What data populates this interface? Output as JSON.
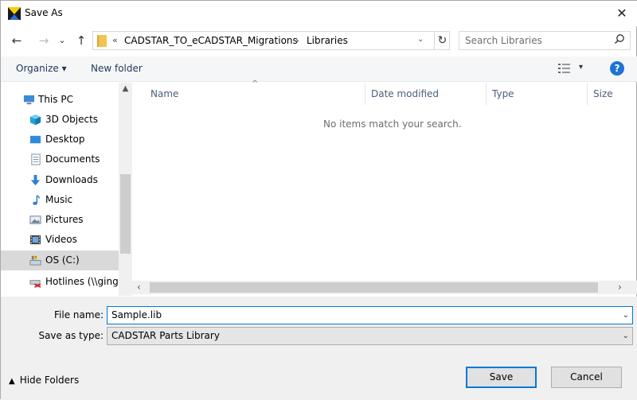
{
  "titlebar": {
    "title": "Save As",
    "close": "✕"
  },
  "nav": {
    "back": "←",
    "forward": "→",
    "history_drop": "⌄",
    "up": "↑",
    "breadcrumb": {
      "overflow": "«",
      "folder": "CADSTAR_TO_eCADSTAR_Migrations",
      "separator": "›",
      "current": "Libraries"
    },
    "addr_drop": "⌄",
    "refresh": "↻",
    "search_placeholder": "Search Libraries"
  },
  "toolbar": {
    "organize": "Organize ▾",
    "new_folder": "New folder",
    "view_drop": "▾",
    "help": "?"
  },
  "sidebar": {
    "items": [
      {
        "label": "This PC",
        "icon": "computer-icon"
      },
      {
        "label": "3D Objects",
        "icon": "cube-icon"
      },
      {
        "label": "Desktop",
        "icon": "desktop-icon"
      },
      {
        "label": "Documents",
        "icon": "documents-icon"
      },
      {
        "label": "Downloads",
        "icon": "downloads-icon"
      },
      {
        "label": "Music",
        "icon": "music-icon"
      },
      {
        "label": "Pictures",
        "icon": "pictures-icon"
      },
      {
        "label": "Videos",
        "icon": "videos-icon"
      },
      {
        "label": "OS (C:)",
        "icon": "drive-icon"
      },
      {
        "label": "Hotlines (\\\\ginge",
        "icon": "network-drive-icon"
      }
    ]
  },
  "content": {
    "columns": [
      "Name",
      "Date modified",
      "Type",
      "Size"
    ],
    "empty_message": "No items match your search."
  },
  "form": {
    "filename_label": "File name:",
    "filename_value": "Sample.lib",
    "savetype_label": "Save as type:",
    "savetype_value": "CADSTAR Parts Library",
    "hide_folders": "Hide Folders",
    "save": "Save",
    "cancel": "Cancel"
  },
  "colors": {
    "accent": "#0078d7",
    "toolbar_bg": "#f5f6f7",
    "form_bg": "#f0f0f0"
  }
}
